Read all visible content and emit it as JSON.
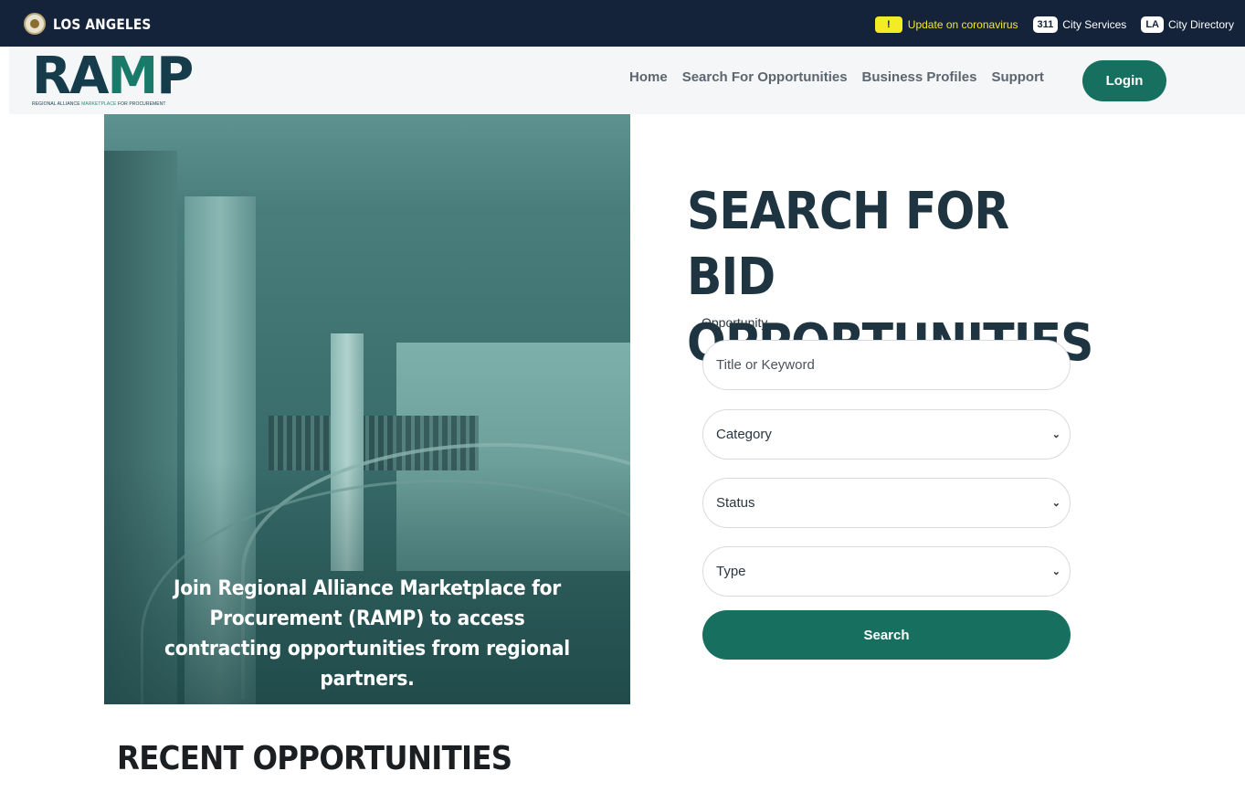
{
  "citybar": {
    "name": "LOS ANGELES",
    "alert_badge": "!",
    "alert_text": "Update on coronavirus",
    "services_pill": "311",
    "services_label": "City Services",
    "directory_pill": "LA",
    "directory_label": "City Directory"
  },
  "header": {
    "logo_r": "R",
    "logo_a": "A",
    "logo_m": "M",
    "logo_p": "P",
    "logo_sub_a": "REGIONAL ALLIANCE ",
    "logo_sub_b": "MARKETPLACE",
    "logo_sub_c": " FOR PROCUREMENT",
    "nav": [
      "Home",
      "Search For Opportunities",
      "Business Profiles",
      "Support"
    ],
    "login_label": "Login"
  },
  "hero": {
    "caption": "Join Regional Alliance Marketplace for Procurement (RAMP) to access contracting opportunities from regional partners."
  },
  "search": {
    "title_line1": "SEARCH FOR BID",
    "title_line2": "OPPORTUNITIES",
    "label": "Opportunity",
    "keyword_placeholder": "Title or Keyword",
    "category": "Category",
    "status": "Status",
    "type": "Type",
    "button_label": "Search"
  },
  "recent": {
    "title": "RECENT OPPORTUNITIES"
  },
  "colors": {
    "citybar_bg": "#14223a",
    "accent_green": "#17705f",
    "alert_yellow": "#f3ec24",
    "title_dark": "#1f3441"
  }
}
